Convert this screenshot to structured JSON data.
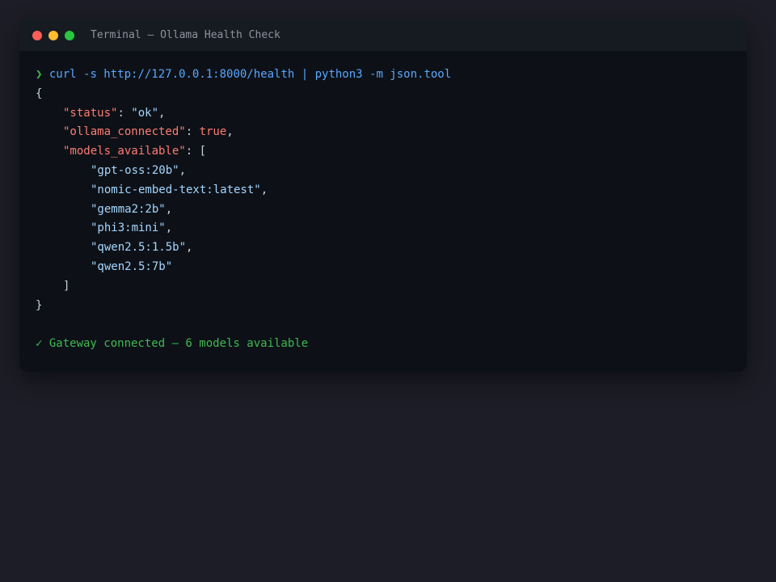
{
  "window": {
    "title": "Terminal — Ollama Health Check",
    "colors": {
      "close": "#ff5f57",
      "minimize": "#febc2e",
      "maximize": "#28c840"
    }
  },
  "terminal": {
    "prompt_symbol": "❯",
    "command": "curl -s http://127.0.0.1:8000/health | python3 -m json.tool",
    "open_brace": "{",
    "close_brace": "}",
    "fields": {
      "status_key": "\"status\"",
      "status_value": "\"ok\"",
      "connected_key": "\"ollama_connected\"",
      "connected_value": "true",
      "models_key": "\"models_available\"",
      "models_open": "[",
      "models_close": "]"
    },
    "models": [
      "\"gpt-oss:20b\"",
      "\"nomic-embed-text:latest\"",
      "\"gemma2:2b\"",
      "\"phi3:mini\"",
      "\"qwen2.5:1.5b\"",
      "\"qwen2.5:7b\""
    ],
    "status_message": "✓ Gateway connected — 6 models available"
  }
}
